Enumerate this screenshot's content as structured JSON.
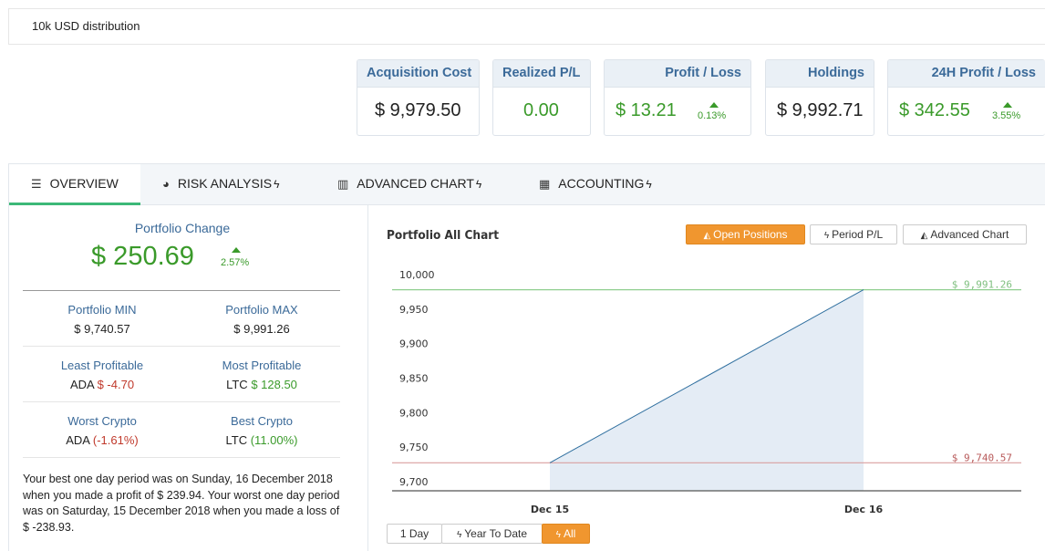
{
  "header": {
    "title": "10k USD distribution"
  },
  "cards": [
    {
      "label": "Acquisition Cost",
      "value": "$ 9,979.50"
    },
    {
      "label": "Realized P/L",
      "value": "0.00"
    },
    {
      "label": "Profit / Loss",
      "value": "$ 13.21",
      "pct": "0.13%"
    },
    {
      "label": "Holdings",
      "value": "$ 9,992.71"
    },
    {
      "label": "24H Profit / Loss",
      "value": "$ 342.55",
      "pct": "3.55%"
    }
  ],
  "tabs": [
    {
      "label": "OVERVIEW",
      "icon": "list-icon"
    },
    {
      "label": "RISK ANALYSIS",
      "icon": "pie-chart-icon"
    },
    {
      "label": "ADVANCED CHART",
      "icon": "bar-chart-icon"
    },
    {
      "label": "ACCOUNTING",
      "icon": "calculator-icon"
    }
  ],
  "portfolio": {
    "change_label": "Portfolio Change",
    "change_value": "$ 250.69",
    "change_pct": "2.57%",
    "min_label": "Portfolio MIN",
    "min_value": "$ 9,740.57",
    "max_label": "Portfolio MAX",
    "max_value": "$ 9,991.26",
    "least_label": "Least Profitable",
    "least_coin": "ADA",
    "least_value": "$ -4.70",
    "most_label": "Most Profitable",
    "most_coin": "LTC",
    "most_value": "$ 128.50",
    "worst_label": "Worst Crypto",
    "worst_coin": "ADA",
    "worst_value": "(-1.61%)",
    "best_label": "Best Crypto",
    "best_coin": "LTC",
    "best_value": "(11.00%)",
    "summary": "Your best one day period was on Sunday, 16 December 2018 when you made a profit of $ 239.94. Your worst one day period was on Saturday, 15 December 2018 when you made a loss of $ -238.93."
  },
  "chart_panel": {
    "title": "Portfolio All Chart",
    "buttons": [
      {
        "label": "Open Positions",
        "icon": "area-chart-icon",
        "active": true
      },
      {
        "label": "Period P/L",
        "icon": "bolt-icon",
        "active": false
      },
      {
        "label": "Advanced Chart",
        "icon": "area-chart-icon",
        "active": false
      }
    ],
    "ranges": [
      {
        "label": "1 Day",
        "icon": "",
        "active": false
      },
      {
        "label": "Year To Date",
        "icon": "bolt-icon",
        "active": false
      },
      {
        "label": "All",
        "icon": "bolt-icon",
        "active": true
      }
    ]
  },
  "chart_data": {
    "type": "area",
    "x": [
      "Dec 15",
      "Dec 16"
    ],
    "values": [
      9740.57,
      9991.26
    ],
    "ylim": [
      9700,
      10000
    ],
    "yticks": [
      10000,
      9950,
      9900,
      9850,
      9800,
      9750,
      9700
    ],
    "ytick_labels": [
      "10,000",
      "9,950",
      "9,900",
      "9,850",
      "9,800",
      "9,750",
      "9,700"
    ],
    "max_line": {
      "value": 9991.26,
      "label": "$ 9,991.26",
      "color": "#8fcf8f"
    },
    "min_line": {
      "value": 9740.57,
      "label": "$ 9,740.57",
      "color": "#d9a0a0"
    },
    "line_color": "#2f6f9f",
    "fill_color": "#e4ecf5",
    "grid": false
  },
  "colors": {
    "accent_green": "#3a9a2a",
    "accent_blue": "#3b6a99",
    "orange": "#f0962f",
    "loss_red": "#c0392b",
    "tab_active": "#3cb878"
  }
}
